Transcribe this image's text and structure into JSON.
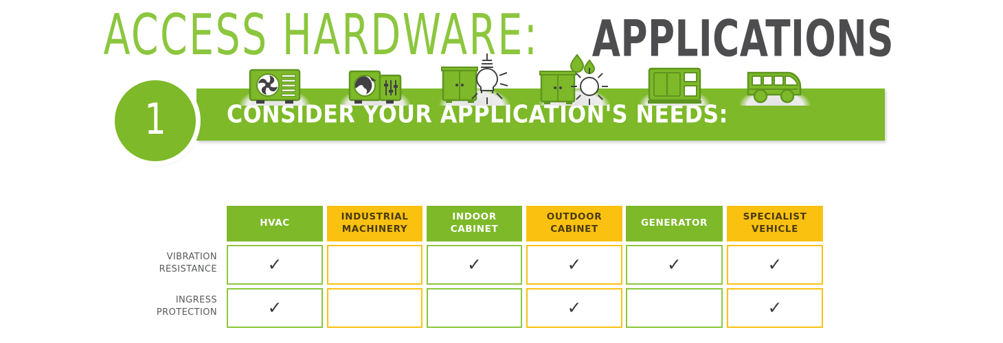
{
  "title": {
    "light_part": "ACCESS HARDWARE:",
    "bold_part": "APPLICATIONS"
  },
  "banner": {
    "step_number": "1",
    "heading": "CONSIDER YOUR APPLICATION'S NEEDS:"
  },
  "colors": {
    "green": "#7DB928",
    "green_light": "#8CC63E",
    "yellow": "#FBC111",
    "title_gray": "#4D4D4F",
    "label_gray": "#58595B",
    "check_gray": "#3A3A3A"
  },
  "table": {
    "row_labels": [
      "VIBRATION\nRESISTANCE",
      "INGRESS\nPROTECTION"
    ],
    "row_labels_lines": [
      [
        "VIBRATION",
        "RESISTANCE"
      ],
      [
        "INGRESS",
        "PROTECTION"
      ]
    ],
    "columns": [
      {
        "label_lines": [
          "HVAC"
        ],
        "icon": "hvac-unit-icon",
        "accent": "green",
        "checks": [
          true,
          true
        ]
      },
      {
        "label_lines": [
          "INDUSTRIAL",
          "MACHINERY"
        ],
        "icon": "industrial-machinery-icon",
        "accent": "yellow",
        "checks": [
          false,
          false
        ]
      },
      {
        "label_lines": [
          "INDOOR",
          "CABINET"
        ],
        "icon": "indoor-cabinet-lightbulb-icon",
        "accent": "green",
        "checks": [
          true,
          false
        ]
      },
      {
        "label_lines": [
          "OUTDOOR",
          "CABINET"
        ],
        "icon": "outdoor-cabinet-sun-rain-icon",
        "accent": "yellow",
        "checks": [
          true,
          true
        ]
      },
      {
        "label_lines": [
          "GENERATOR"
        ],
        "icon": "generator-icon",
        "accent": "green",
        "checks": [
          true,
          false
        ]
      },
      {
        "label_lines": [
          "SPECIALIST",
          "VEHICLE"
        ],
        "icon": "specialist-vehicle-bus-icon",
        "accent": "yellow",
        "checks": [
          true,
          true
        ]
      }
    ],
    "check_glyph": "✓"
  }
}
